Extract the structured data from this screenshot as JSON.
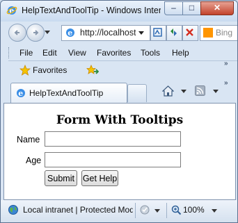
{
  "window": {
    "title": "HelpTextAndToolTip - Windows Internet Explorer",
    "minimize_glyph": "–",
    "maximize_glyph": "□",
    "close_glyph": "✕"
  },
  "address_bar": {
    "url": "http://localhost/",
    "search_placeholder": "Bing"
  },
  "menu": {
    "items": [
      "File",
      "Edit",
      "View",
      "Favorites",
      "Tools",
      "Help"
    ]
  },
  "favorites_bar": {
    "favorites_label": "Favorites"
  },
  "tabs": {
    "active_label": "HelpTextAndToolTip"
  },
  "page": {
    "form_title": "Form With Tooltips",
    "name_label": "Name",
    "name_value": "",
    "age_label": "Age",
    "age_value": "",
    "submit_label": "Submit",
    "help_label": "Get Help"
  },
  "status_bar": {
    "zone_text": "Local intranet | Protected Mode: Off",
    "zoom_text": "100%"
  },
  "colors": {
    "chrome_bg": "#d9e5f3",
    "close_button": "#c2432b",
    "bing_logo": "#ff9500"
  },
  "icons": [
    "ie-page-icon",
    "back-arrow-icon",
    "forward-arrow-icon",
    "compat-view-icon",
    "refresh-icon",
    "stop-icon",
    "favorites-star-icon",
    "add-favorite-icon",
    "home-icon",
    "feed-icon",
    "globe-icon",
    "protected-mode-icon",
    "zoom-icon"
  ]
}
